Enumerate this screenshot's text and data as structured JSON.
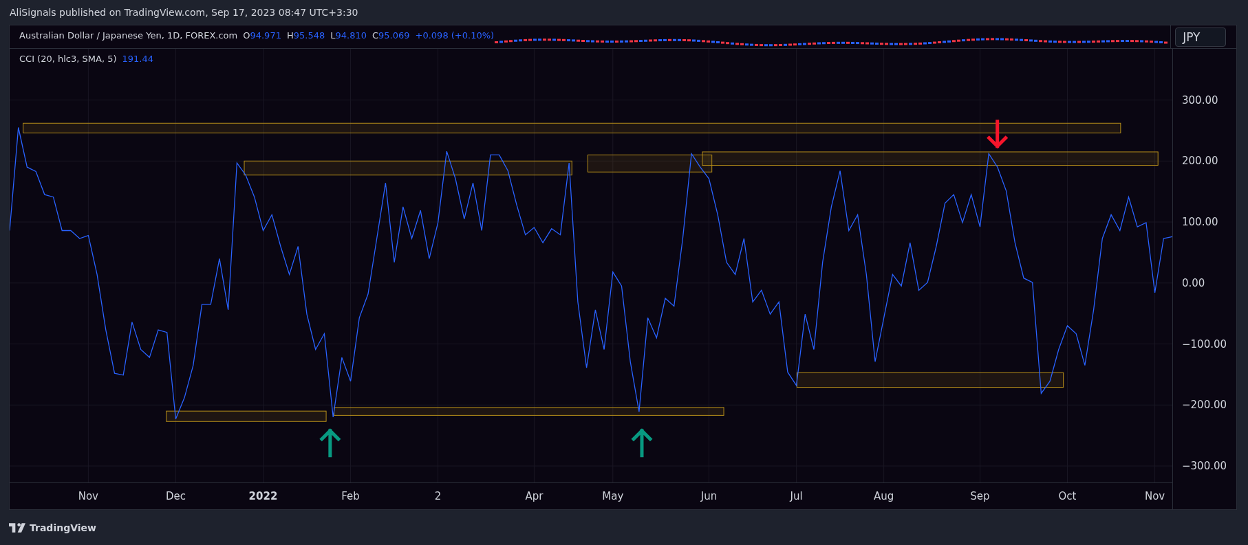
{
  "header": {
    "published": "AliSignals published on TradingView.com, Sep 17, 2023 08:47 UTC+3:30"
  },
  "price_pane": {
    "symbol": "Australian Dollar / Japanese Yen, 1D, FOREX.com",
    "ohlc": [
      {
        "label": "O",
        "value": "94.971"
      },
      {
        "label": "H",
        "value": "95.548"
      },
      {
        "label": "L",
        "value": "94.810"
      },
      {
        "label": "C",
        "value": "95.069"
      }
    ],
    "change": "+0.098 (+0.10%)",
    "currency": "JPY"
  },
  "indicator_pane": {
    "name": "CCI (20, hlc3, SMA, 5)",
    "value": "191.44",
    "time_axis": [
      {
        "kind": "month"
      },
      {
        "kind": "month"
      },
      {
        "kind": "year"
      },
      {
        "kind": "month"
      },
      {
        "kind": "month"
      },
      {
        "kind": "month"
      },
      {
        "kind": "month"
      },
      {
        "kind": "month"
      },
      {
        "kind": "month"
      },
      {
        "kind": "month"
      },
      {
        "kind": "month"
      },
      {
        "kind": "month"
      },
      {
        "kind": "month"
      }
    ],
    "chart_data": {
      "type": "line",
      "grid": true,
      "ylim": [
        -327,
        384
      ],
      "categories": [
        null,
        null,
        null,
        null,
        null,
        null,
        null,
        null,
        null,
        "Nov",
        null,
        null,
        null,
        null,
        null,
        null,
        null,
        null,
        null,
        "Dec",
        null,
        null,
        null,
        null,
        null,
        null,
        null,
        null,
        null,
        "2022",
        null,
        null,
        null,
        null,
        null,
        null,
        null,
        null,
        null,
        "Feb",
        null,
        null,
        null,
        null,
        null,
        null,
        null,
        null,
        null,
        "2",
        null,
        null,
        null,
        null,
        null,
        null,
        null,
        null,
        null,
        null,
        "Apr",
        null,
        null,
        null,
        null,
        null,
        null,
        null,
        null,
        "May",
        null,
        null,
        null,
        null,
        null,
        null,
        null,
        null,
        null,
        null,
        "Jun",
        null,
        null,
        null,
        null,
        null,
        null,
        null,
        null,
        null,
        "Jul",
        null,
        null,
        null,
        null,
        null,
        null,
        null,
        null,
        null,
        "Aug",
        null,
        null,
        null,
        null,
        null,
        null,
        null,
        null,
        null,
        null,
        "Sep",
        null,
        null,
        null,
        null,
        null,
        null,
        null,
        null,
        null,
        "Oct",
        null,
        null,
        null,
        null,
        null,
        null,
        null,
        null,
        null,
        "Nov",
        null,
        null
      ],
      "yticks": [
        {
          "value": 300,
          "label": "300.00"
        },
        {
          "value": 200,
          "label": "200.00"
        },
        {
          "value": 100,
          "label": "100.00"
        },
        {
          "value": 0,
          "label": "0.00"
        },
        {
          "value": -100,
          "label": "−100.00"
        },
        {
          "value": -200,
          "label": "−200.00"
        },
        {
          "value": -300,
          "label": "−300.00"
        }
      ],
      "series": [
        {
          "color": "#2962ff",
          "values": [
            86,
            255,
            190,
            183,
            145,
            141,
            86,
            86,
            73,
            78,
            14,
            -77,
            -148,
            -151,
            -64,
            -109,
            -122,
            -77,
            -81,
            -223,
            -188,
            -135,
            -35,
            -35,
            40,
            -44,
            197,
            177,
            141,
            86,
            112,
            60,
            14,
            60,
            -51,
            -109,
            -83,
            -220,
            -122,
            -161,
            -57,
            -18,
            73,
            164,
            34,
            125,
            73,
            119,
            40,
            99,
            216,
            171,
            105,
            164,
            86,
            210,
            210,
            184,
            128,
            79,
            91,
            66,
            89,
            79,
            197,
            -31,
            -139,
            -44,
            -109,
            18,
            -5,
            -129,
            -211,
            -57,
            -90,
            -25,
            -38,
            73,
            212,
            190,
            171,
            112,
            34,
            14,
            73,
            -31,
            -12,
            -51,
            -31,
            -146,
            -168,
            -51,
            -109,
            34,
            125,
            184,
            86,
            112,
            14,
            -129,
            -57,
            14,
            -5,
            66,
            -12,
            1,
            60,
            131,
            145,
            99,
            145,
            92,
            212,
            190,
            151,
            66,
            8,
            1,
            -181,
            -161,
            -109,
            -70,
            -83,
            -135,
            -44,
            73,
            112,
            86,
            141,
            92,
            99,
            -16,
            73,
            76
          ]
        }
      ]
    },
    "drawings": [
      {
        "kind": "rect"
      },
      {
        "kind": "rect"
      },
      {
        "kind": "rect"
      },
      {
        "kind": "rect"
      },
      {
        "kind": "rect"
      },
      {
        "kind": "rect"
      },
      {
        "kind": "rect"
      },
      {
        "kind": "up_arrow",
        "color": "#089981"
      },
      {
        "kind": "up_arrow",
        "color": "#089981"
      },
      {
        "kind": "down_arrow",
        "color": "#f7152b"
      }
    ]
  },
  "footer": {
    "brand": "TradingView"
  }
}
